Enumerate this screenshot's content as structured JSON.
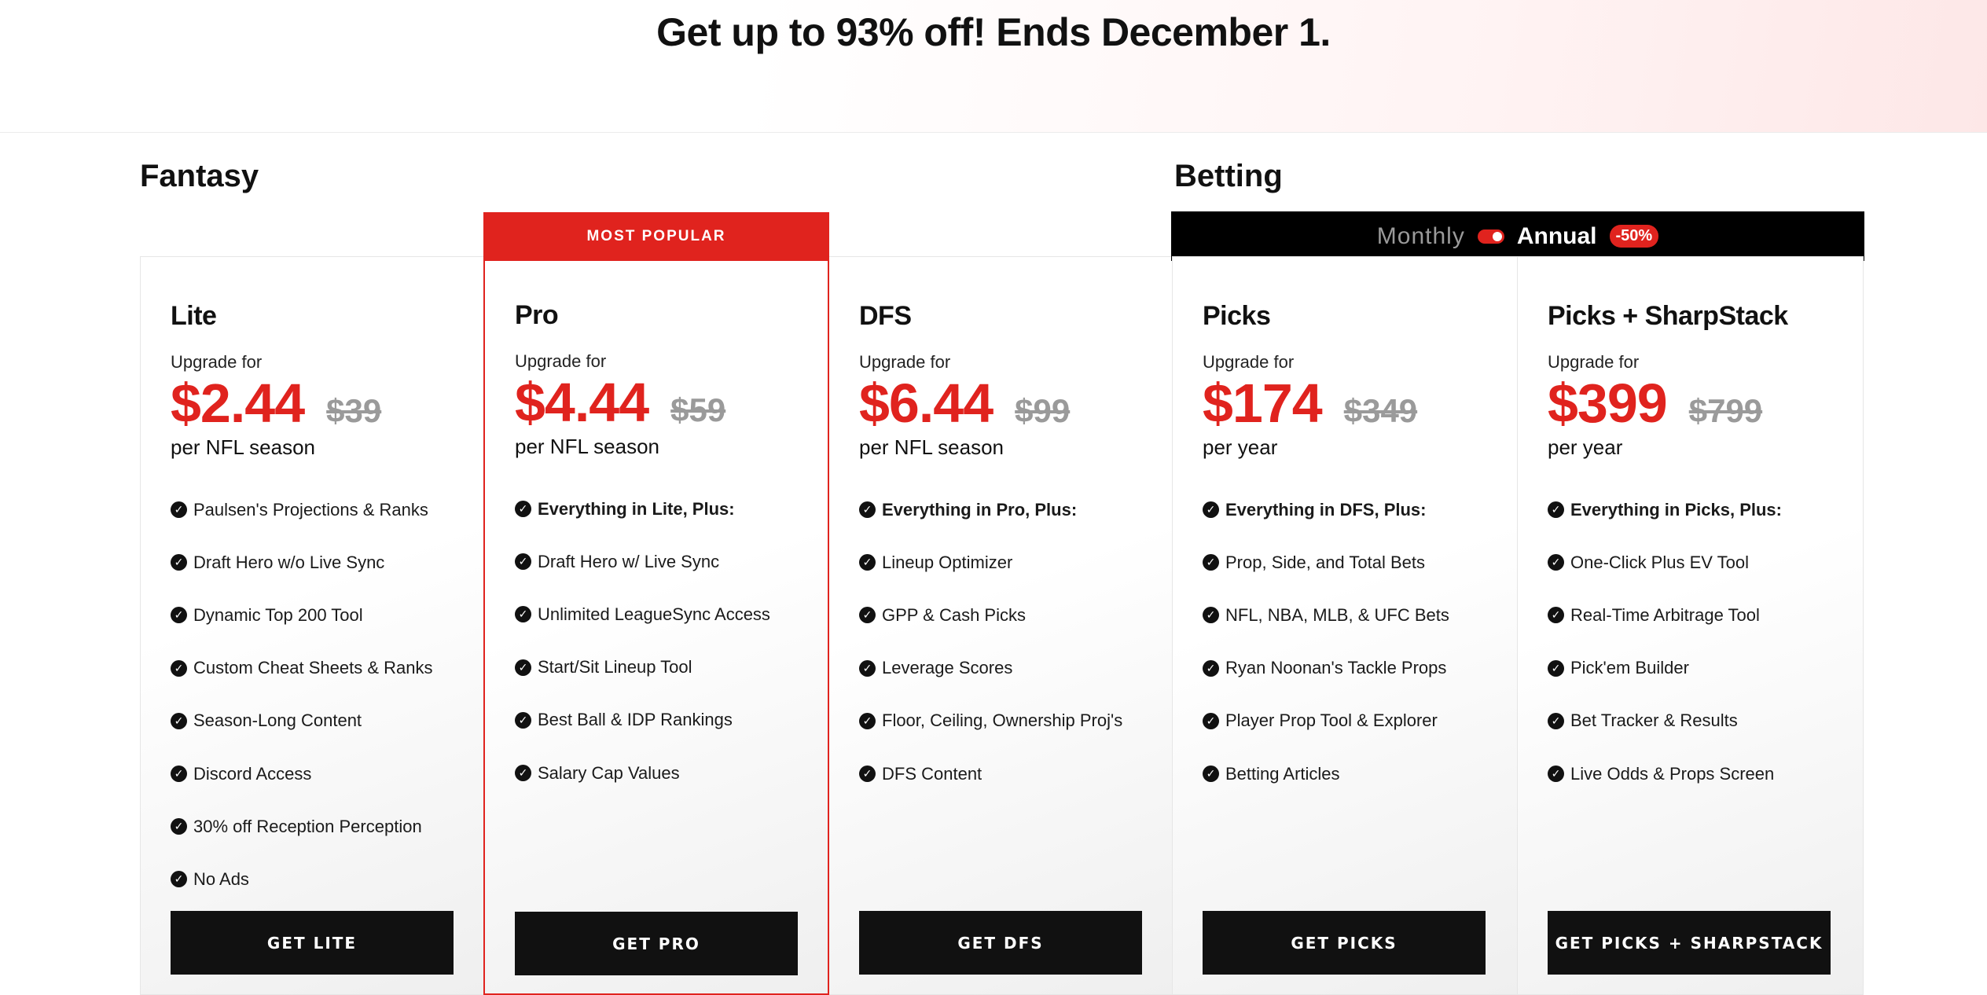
{
  "banner": {
    "headline": "Get up to 93% off! Ends December 1."
  },
  "sections": {
    "fantasy": "Fantasy",
    "betting": "Betting"
  },
  "badges": {
    "most_popular": "MOST POPULAR"
  },
  "billing_toggle": {
    "monthly_label": "Monthly",
    "annual_label": "Annual",
    "discount": "-50%",
    "selected": "Annual"
  },
  "colors": {
    "accent": "#e0231e",
    "dark": "#111111",
    "muted": "#9a9a9a"
  },
  "plans": [
    {
      "name": "Lite",
      "upgrade_label": "Upgrade for",
      "price": "$2.44",
      "original_price": "$39",
      "period": "per NFL season",
      "cta": "GET LITE",
      "features": [
        {
          "text": "Paulsen's Projections & Ranks",
          "bold": false
        },
        {
          "text": "Draft Hero w/o Live Sync",
          "bold": false
        },
        {
          "text": "Dynamic Top 200 Tool",
          "bold": false
        },
        {
          "text": "Custom Cheat Sheets & Ranks",
          "bold": false
        },
        {
          "text": "Season-Long Content",
          "bold": false
        },
        {
          "text": "Discord Access",
          "bold": false
        },
        {
          "text": "30% off Reception Perception",
          "bold": false
        },
        {
          "text": "No Ads",
          "bold": false
        }
      ]
    },
    {
      "name": "Pro",
      "upgrade_label": "Upgrade for",
      "price": "$4.44",
      "original_price": "$59",
      "period": "per NFL season",
      "cta": "GET PRO",
      "features": [
        {
          "text": "Everything in Lite, Plus:",
          "bold": true
        },
        {
          "text": "Draft Hero w/ Live Sync",
          "bold": false
        },
        {
          "text": "Unlimited LeagueSync Access",
          "bold": false
        },
        {
          "text": "Start/Sit Lineup Tool",
          "bold": false
        },
        {
          "text": "Best Ball & IDP Rankings",
          "bold": false
        },
        {
          "text": "Salary Cap Values",
          "bold": false
        }
      ]
    },
    {
      "name": "DFS",
      "upgrade_label": "Upgrade for",
      "price": "$6.44",
      "original_price": "$99",
      "period": "per NFL season",
      "cta": "GET DFS",
      "features": [
        {
          "text": "Everything in Pro, Plus:",
          "bold": true
        },
        {
          "text": "Lineup Optimizer",
          "bold": false
        },
        {
          "text": "GPP & Cash Picks",
          "bold": false
        },
        {
          "text": "Leverage Scores",
          "bold": false
        },
        {
          "text": "Floor, Ceiling, Ownership Proj's",
          "bold": false
        },
        {
          "text": "DFS Content",
          "bold": false
        }
      ]
    },
    {
      "name": "Picks",
      "upgrade_label": "Upgrade for",
      "price": "$174",
      "original_price": "$349",
      "period": "per year",
      "cta": "GET PICKS",
      "features": [
        {
          "text": "Everything in DFS, Plus:",
          "bold": true
        },
        {
          "text": "Prop, Side, and Total Bets",
          "bold": false
        },
        {
          "text": "NFL, NBA, MLB, & UFC Bets",
          "bold": false
        },
        {
          "text": "Ryan Noonan's Tackle Props",
          "bold": false
        },
        {
          "text": "Player Prop Tool & Explorer",
          "bold": false
        },
        {
          "text": "Betting Articles",
          "bold": false
        }
      ]
    },
    {
      "name": "Picks + SharpStack",
      "upgrade_label": "Upgrade for",
      "price": "$399",
      "original_price": "$799",
      "period": "per year",
      "cta": "GET PICKS + SHARPSTACK",
      "features": [
        {
          "text": "Everything in Picks, Plus:",
          "bold": true
        },
        {
          "text": "One-Click Plus EV Tool",
          "bold": false
        },
        {
          "text": "Real-Time Arbitrage Tool",
          "bold": false
        },
        {
          "text": "Pick'em Builder",
          "bold": false
        },
        {
          "text": "Bet Tracker & Results",
          "bold": false
        },
        {
          "text": "Live Odds & Props Screen",
          "bold": false
        }
      ]
    }
  ]
}
